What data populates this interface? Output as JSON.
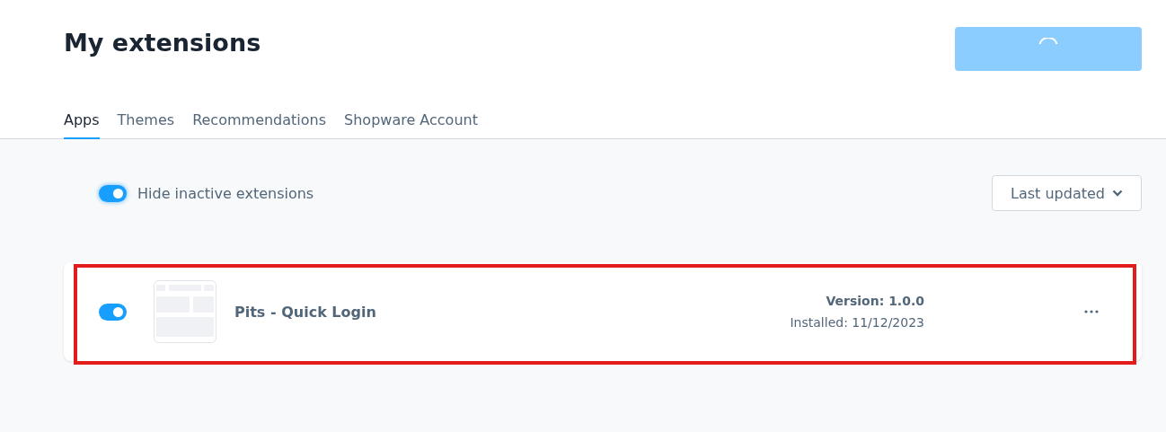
{
  "header": {
    "title": "My extensions",
    "action_button": {
      "loading": true
    }
  },
  "tabs": [
    {
      "label": "Apps",
      "selected": true
    },
    {
      "label": "Themes",
      "selected": false
    },
    {
      "label": "Recommendations",
      "selected": false
    },
    {
      "label": "Shopware Account",
      "selected": false
    }
  ],
  "filter": {
    "label": "Hide inactive extensions",
    "on": true
  },
  "sort": {
    "label": "Last updated"
  },
  "extensions": [
    {
      "name": "Pits - Quick Login",
      "active": true,
      "version": "Version: 1.0.0",
      "installed": "Installed: 11/12/2023",
      "highlighted": true
    }
  ]
}
